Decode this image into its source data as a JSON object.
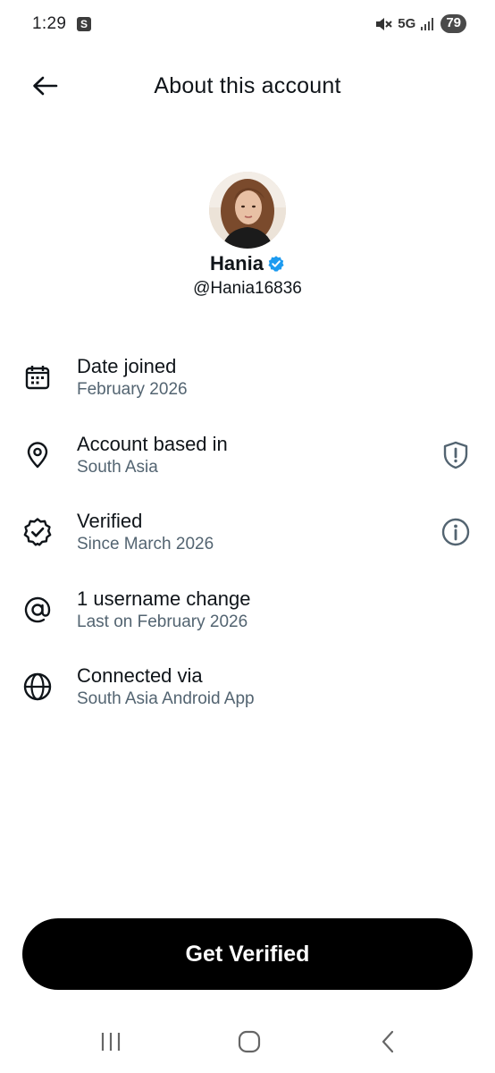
{
  "status_bar": {
    "time": "1:29",
    "app_icon_letter": "S",
    "network": "5G",
    "battery": "79",
    "icons": [
      "mute-icon",
      "signal-icon"
    ]
  },
  "header": {
    "title": "About this account",
    "back_icon": "arrow-left-icon"
  },
  "profile": {
    "name": "Hania",
    "handle": "@Hania16836",
    "verified_color": "#1d9bf0"
  },
  "info": [
    {
      "icon": "calendar-icon",
      "title": "Date joined",
      "subtitle": "February 2026"
    },
    {
      "icon": "location-pin-icon",
      "title": "Account based in",
      "subtitle": "South Asia",
      "action_icon": "shield-alert-icon"
    },
    {
      "icon": "verified-seal-icon",
      "title": "Verified",
      "subtitle": "Since March 2026",
      "action_icon": "info-icon"
    },
    {
      "icon": "at-sign-icon",
      "title": "1 username change",
      "subtitle": "Last on February 2026"
    },
    {
      "icon": "globe-icon",
      "title": "Connected via",
      "subtitle": "South Asia Android App"
    }
  ],
  "cta": {
    "label": "Get Verified"
  },
  "nav_bar": {
    "icons": [
      "recents-icon",
      "home-icon",
      "back-icon"
    ]
  },
  "colors": {
    "text": "#0f1419",
    "secondary": "#536471",
    "accent": "#1d9bf0",
    "button_bg": "#000000"
  }
}
